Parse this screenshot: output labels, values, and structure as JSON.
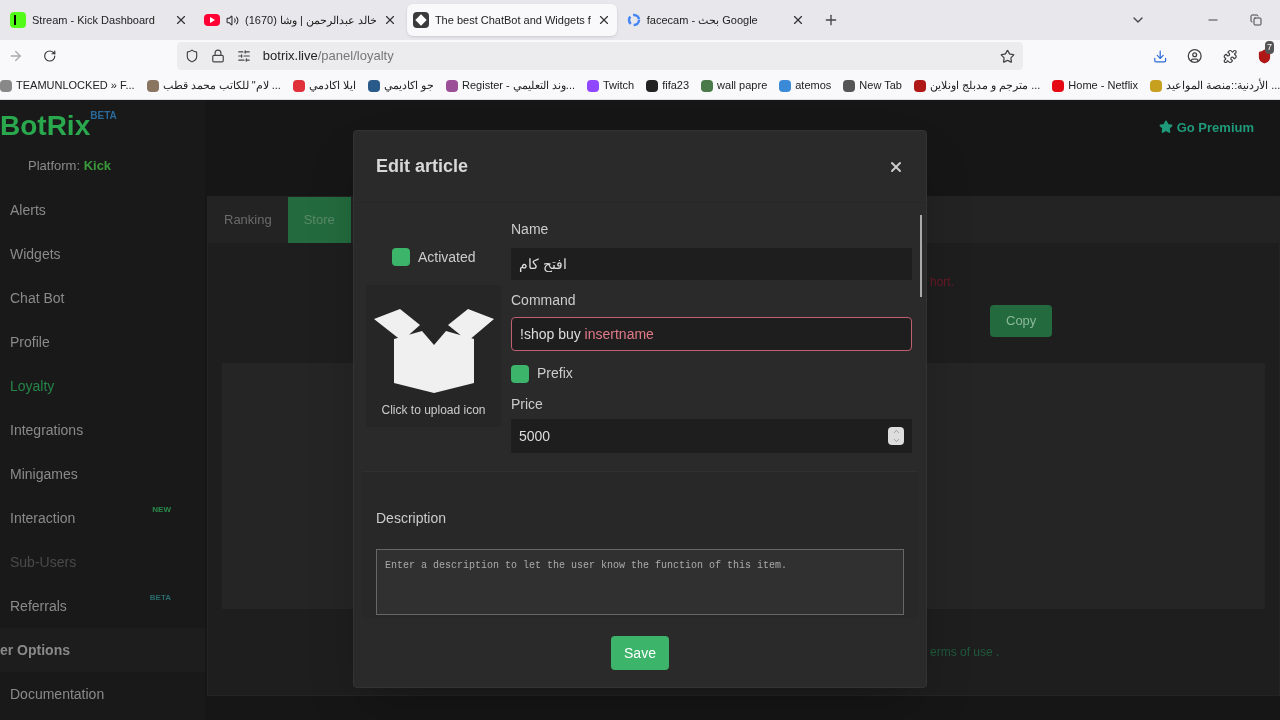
{
  "browser": {
    "tabs": [
      {
        "title": "Stream - Kick Dashboard",
        "kind": "kick",
        "selected": false,
        "audio": false
      },
      {
        "title": "(1670) خالد عبدالرحمن | وشا",
        "kind": "youtube",
        "selected": false,
        "audio": true
      },
      {
        "title": "The best ChatBot and Widgets f",
        "kind": "botrix",
        "selected": true,
        "audio": false
      },
      {
        "title": "facecam - بحث Google",
        "kind": "google",
        "selected": false,
        "audio": false
      }
    ],
    "address": {
      "host": "botrix.live",
      "path": "/panel/loyalty"
    },
    "extension_badge": "7",
    "bookmarks": [
      {
        "label": "TEAMUNLOCKED » F...",
        "color": "#888888"
      },
      {
        "label": "لام\" للكاتب محمد قطب ...",
        "color": "#8a7560"
      },
      {
        "label": "ايلا اكادمي",
        "color": "#e0303a"
      },
      {
        "label": "جو اكاديمي",
        "color": "#2a5a8a"
      },
      {
        "label": "Register - وند التعليمي...",
        "color": "#9b4f96"
      },
      {
        "label": "Twitch",
        "color": "#9146ff"
      },
      {
        "label": "fifa23",
        "color": "#222222"
      },
      {
        "label": "wall papre",
        "color": "#4a7a4a"
      },
      {
        "label": "atemos",
        "color": "#3a8ad8"
      },
      {
        "label": "New Tab",
        "color": "#555555"
      },
      {
        "label": "مترجم و مدبلج اونلاين ...",
        "color": "#b01818"
      },
      {
        "label": "Home - Netflix",
        "color": "#e50914"
      },
      {
        "label": "الأردنية::منصة المواعيد ...",
        "color": "#c8a020"
      }
    ]
  },
  "app": {
    "logo": "BotRix",
    "logo_badge": "BETA",
    "platform_label": "Platform:",
    "platform": "Kick",
    "premium": "Go Premium",
    "sidebar": {
      "items": [
        {
          "label": "Alerts",
          "selected": false,
          "disabled": false
        },
        {
          "label": "Widgets",
          "selected": false,
          "disabled": false
        },
        {
          "label": "Chat Bot",
          "selected": false,
          "disabled": false
        },
        {
          "label": "Profile",
          "selected": false,
          "disabled": false
        },
        {
          "label": "Loyalty",
          "selected": true,
          "disabled": false
        },
        {
          "label": "Integrations",
          "selected": false,
          "disabled": false
        },
        {
          "label": "Minigames",
          "selected": false,
          "disabled": false
        },
        {
          "label": "Interaction",
          "selected": false,
          "disabled": false,
          "badge": {
            "text": "NEW",
            "color": "#2a8a4a"
          }
        },
        {
          "label": "Sub-Users",
          "selected": false,
          "disabled": true
        },
        {
          "label": "Referrals",
          "selected": false,
          "disabled": false,
          "badge": {
            "text": "BETA",
            "color": "#2a6a6a"
          }
        }
      ],
      "section": "er Options",
      "section_items": [
        "Documentation"
      ]
    },
    "tabs": [
      {
        "label": "Ranking",
        "selected": false
      },
      {
        "label": "Store",
        "selected": true
      }
    ],
    "warning_fragment": "hort.",
    "copy_button": "Copy",
    "footer_fragment": "erms of use ."
  },
  "dialog": {
    "title": "Edit article",
    "activated": {
      "label": "Activated",
      "checked": true
    },
    "upload_label": "Click to upload icon",
    "name": {
      "label": "Name",
      "value": "افتح كام"
    },
    "command": {
      "label": "Command",
      "value": "!shop buy ",
      "highlight": "insertname",
      "invalid": true
    },
    "prefix": {
      "label": "Prefix",
      "checked": true
    },
    "price": {
      "label": "Price",
      "value": "5000"
    },
    "description": {
      "label": "Description",
      "placeholder": "Enter a description to let the user know the function of this item."
    },
    "save": "Save"
  }
}
